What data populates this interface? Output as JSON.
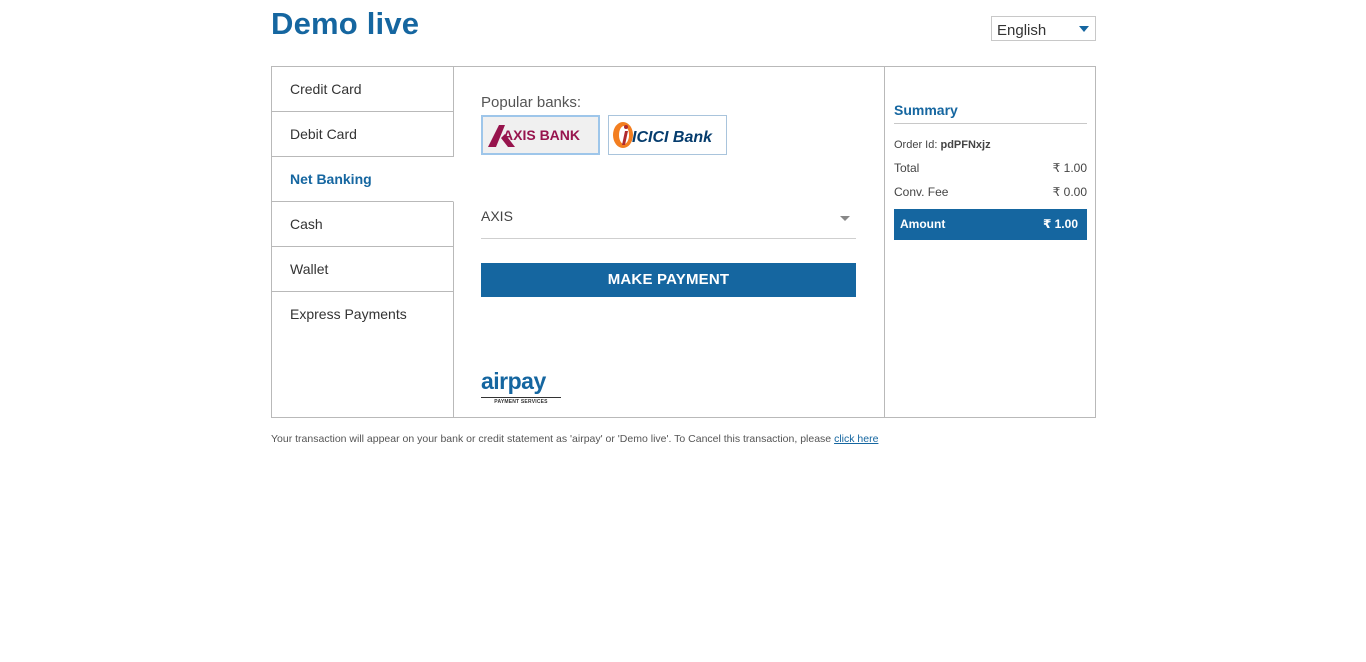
{
  "header": {
    "merchant_name": "Demo live",
    "language": "English"
  },
  "tabs": [
    {
      "label": "Credit Card",
      "active": false
    },
    {
      "label": "Debit Card",
      "active": false
    },
    {
      "label": "Net Banking",
      "active": true
    },
    {
      "label": "Cash",
      "active": false
    },
    {
      "label": "Wallet",
      "active": false
    },
    {
      "label": "Express Payments",
      "active": false
    }
  ],
  "netbanking": {
    "popular_label": "Popular banks:",
    "banks": [
      {
        "name": "AXIS BANK",
        "selected": true
      },
      {
        "name": "ICICI Bank",
        "selected": false
      }
    ],
    "selected_bank": "AXIS",
    "pay_button": "MAKE PAYMENT"
  },
  "brand": {
    "logo_word": "airpay",
    "logo_tag": "PAYMENT SERVICES"
  },
  "summary": {
    "title": "Summary",
    "order_label": "Order Id:",
    "order_id": "pdPFNxjz",
    "total_label": "Total",
    "total_value": "₹ 1.00",
    "fee_label": "Conv. Fee",
    "fee_value": "₹ 0.00",
    "amount_label": "Amount",
    "amount_value": "₹ 1.00"
  },
  "footer": {
    "text": "Your transaction will appear on your bank or credit statement as 'airpay' or 'Demo live'. To Cancel this transaction, please",
    "link": "click here"
  },
  "colors": {
    "brand_blue": "#1566a0",
    "axis_maroon": "#97144d",
    "icici_orange": "#f37e20",
    "icici_blue": "#053c6d"
  }
}
